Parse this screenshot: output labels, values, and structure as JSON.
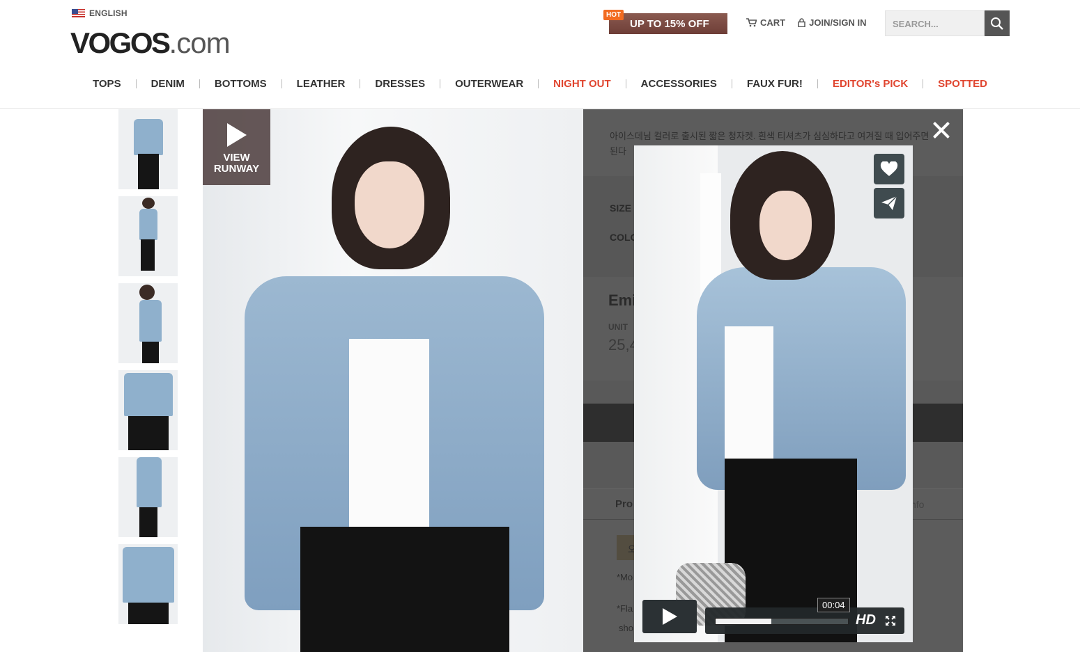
{
  "header": {
    "language": "ENGLISH",
    "logo_main": "VOGOS",
    "logo_domain": ".com",
    "promo_badge": "HOT",
    "promo_text": "UP TO 15% OFF",
    "cart_label": "CART",
    "join_label": "JOIN/SIGN IN",
    "search_placeholder": "SEARCH..."
  },
  "nav": {
    "items": [
      {
        "label": "TOPS"
      },
      {
        "label": "DENIM"
      },
      {
        "label": "BOTTOMS"
      },
      {
        "label": "LEATHER"
      },
      {
        "label": "DRESSES"
      },
      {
        "label": "OUTERWEAR"
      },
      {
        "label": "NIGHT OUT"
      },
      {
        "label": "ACCESSORIES"
      },
      {
        "label": "FAUX FUR!"
      },
      {
        "label": "EDITOR's PICK"
      },
      {
        "label": "SPOTTED"
      }
    ]
  },
  "runway": {
    "line1": "VIEW",
    "line2": "RUNWAY"
  },
  "product": {
    "description": "아이스데님 컬러로 출시된 짧은 청자켓. 흰색 티셔츠가 심심하다고 여겨질 때 입어주면 된다",
    "size_label": "SIZE",
    "color_label": "COLO",
    "name": "Emi",
    "unit_label": "UNIT",
    "price": "25,4",
    "tab_product": "Pro",
    "tab_info": "nfo",
    "chip_text": "오",
    "note1": "*Mo",
    "note2": "*Fla",
    "note3": "sho"
  },
  "video": {
    "time": "00:04",
    "hd_label": "HD",
    "progress": 0.42
  },
  "colors": {
    "accent_red": "#e0452f",
    "promo_orange": "#f26b21",
    "overlay_gray": "#5c5c5c"
  }
}
